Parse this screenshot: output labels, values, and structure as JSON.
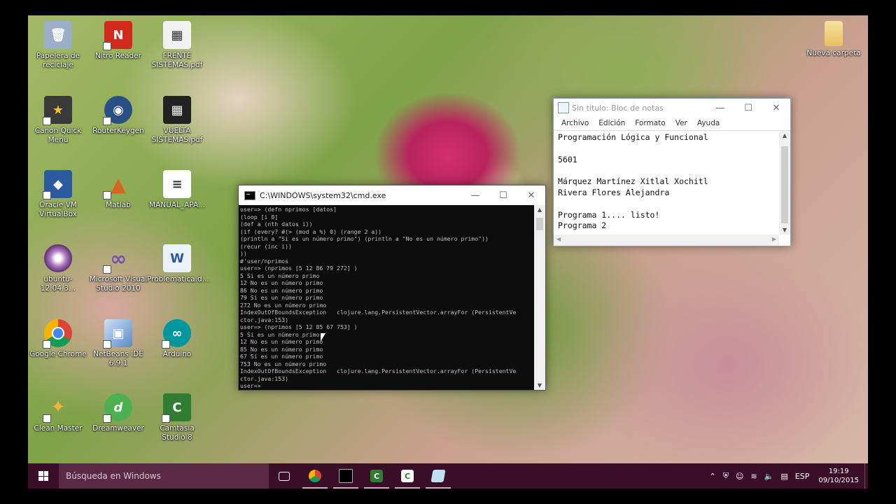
{
  "desktop": {
    "icons": [
      {
        "label": "Papelera de reciclaje",
        "glyph": "🗑",
        "color": "#7a8fb0"
      },
      {
        "label": "Nitro Reader",
        "glyph": "N",
        "color": "#d42a1e"
      },
      {
        "label": "FRENTE SISTEMAS.pdf",
        "glyph": "▦",
        "color": "#f2f2f2"
      },
      {
        "label": "Canon Quick Menu",
        "glyph": "★",
        "color": "#333333"
      },
      {
        "label": "RouterKeygen",
        "glyph": "◉",
        "color": "#2a4f86"
      },
      {
        "label": "VUELTA SISTEMAS.pdf",
        "glyph": "▦",
        "color": "#222222"
      },
      {
        "label": "Oracle VM VirtualBox",
        "glyph": "◆",
        "color": "#2c5aa0"
      },
      {
        "label": "Matlab",
        "glyph": "▲",
        "color": "#d9641e"
      },
      {
        "label": "MANUAL_APA...",
        "glyph": "≡",
        "color": "#ffffff"
      },
      {
        "label": "ubuntu-12.04.3...",
        "glyph": "◎",
        "color": "#8a5a9a"
      },
      {
        "label": "Microsoft Visual Studio 2010",
        "glyph": "∞",
        "color": "#6a3f9a"
      },
      {
        "label": "Problematica.d...",
        "glyph": "W",
        "color": "#2b579a"
      },
      {
        "label": "Google Chrome",
        "glyph": "◕",
        "color": "#db4437"
      },
      {
        "label": "NetBeans IDE 6.9.1",
        "glyph": "▣",
        "color": "#5b8ac8"
      },
      {
        "label": "Arduino",
        "glyph": "∞",
        "color": "#00979d"
      },
      {
        "label": "Clean Master",
        "glyph": "✦",
        "color": "#3b78c4"
      },
      {
        "label": "Dreamweaver",
        "glyph": "d",
        "color": "#4caf50"
      },
      {
        "label": "Camtasia Studio 8",
        "glyph": "C",
        "color": "#2e7d32"
      },
      {
        "label": "Nueva carpeta",
        "glyph": "",
        "color": "#f3d27a"
      }
    ]
  },
  "notepad": {
    "title": "Sin título: Bloc de notas",
    "menu": [
      "Archivo",
      "Edición",
      "Formato",
      "Ver",
      "Ayuda"
    ],
    "content": "Programación Lógica y Funcional\n\n5601\n\nMárquez Martínez Xitlal Xochitl\nRivera Flores Alejandra\n\nPrograma 1.... listo!\nPrograma 2"
  },
  "cmd": {
    "title": "C:\\WINDOWS\\system32\\cmd.exe",
    "lines": [
      "user=> (defn nprimos [datos]",
      "(loop [i 0]",
      "(def a (nth datos i))",
      "(if (every? #(> (mod a %) 0) (range 2 a))",
      "(println a \"Si es un número primo\") (println a \"No es un número primo\"))",
      "(recur (inc i))",
      "))",
      "#'user/nprimos",
      "user=> (nprimos [5 12 86 79 272] )",
      "5 Si es un número primo",
      "12 No es un número primo",
      "86 No es un número primo",
      "79 Si es un número primo",
      "272 No es un número primo",
      "IndexOutOfBoundsException   clojure.lang.PersistentVector.arrayFor (PersistentVe",
      "ctor.java:153)",
      "user=> (nprimos [5 12 85 67 753] )",
      "5 Si es un número primo",
      "12 No es un número primo",
      "85 No es un número primo",
      "67 Si es un número primo",
      "753 No es un número primo",
      "IndexOutOfBoundsException   clojure.lang.PersistentVector.arrayFor (PersistentVe",
      "ctor.java:153)",
      "user=>"
    ]
  },
  "taskbar": {
    "search_placeholder": "Búsqueda en Windows",
    "language": "ESP",
    "time": "19:19",
    "date": "09/10/2015"
  }
}
